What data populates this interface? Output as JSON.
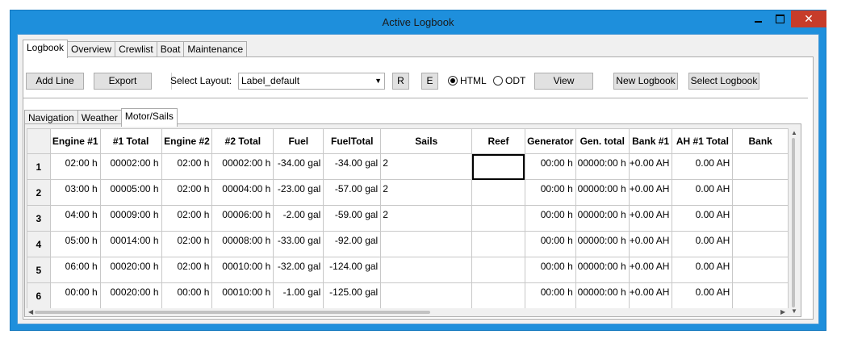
{
  "window": {
    "title": "Active Logbook",
    "close_glyph": "✕"
  },
  "outer_tabs": [
    {
      "label": "Logbook",
      "active": true
    },
    {
      "label": "Overview"
    },
    {
      "label": "Crewlist"
    },
    {
      "label": "Boat"
    },
    {
      "label": "Maintenance"
    }
  ],
  "toolbar": {
    "add_line": "Add Line",
    "export": "Export",
    "select_layout_label": "Select Layout:",
    "layout_value": "Label_default",
    "r_button": "R",
    "e_button": "E",
    "html_radio": "HTML",
    "odt_radio": "ODT",
    "view": "View",
    "new_logbook": "New Logbook",
    "select_logbook": "Select Logbook"
  },
  "inner_tabs": [
    {
      "label": "Navigation"
    },
    {
      "label": "Weather"
    },
    {
      "label": "Motor/Sails",
      "active": true
    }
  ],
  "grid": {
    "columns": [
      "Engine #1",
      "#1 Total",
      "Engine #2",
      "#2 Total",
      "Fuel",
      "FuelTotal",
      "Sails",
      "Reef",
      "Generator",
      "Gen. total",
      "Bank #1",
      "AH #1 Total",
      "Bank"
    ],
    "rows": [
      {
        "n": "1",
        "cells": [
          "02:00 h",
          "00002:00 h",
          "02:00 h",
          "00002:00 h",
          "-34.00 gal",
          "-34.00 gal",
          "2",
          "",
          "00:00 h",
          "00000:00 h",
          "+0.00 AH",
          "0.00 AH",
          ""
        ]
      },
      {
        "n": "2",
        "cells": [
          "03:00 h",
          "00005:00 h",
          "02:00 h",
          "00004:00 h",
          "-23.00 gal",
          "-57.00 gal",
          "2",
          "",
          "00:00 h",
          "00000:00 h",
          "+0.00 AH",
          "0.00 AH",
          ""
        ]
      },
      {
        "n": "3",
        "cells": [
          "04:00 h",
          "00009:00 h",
          "02:00 h",
          "00006:00 h",
          "-2.00 gal",
          "-59.00 gal",
          "2",
          "",
          "00:00 h",
          "00000:00 h",
          "+0.00 AH",
          "0.00 AH",
          ""
        ]
      },
      {
        "n": "4",
        "cells": [
          "05:00 h",
          "00014:00 h",
          "02:00 h",
          "00008:00 h",
          "-33.00 gal",
          "-92.00 gal",
          "",
          "",
          "00:00 h",
          "00000:00 h",
          "+0.00 AH",
          "0.00 AH",
          ""
        ]
      },
      {
        "n": "5",
        "cells": [
          "06:00 h",
          "00020:00 h",
          "02:00 h",
          "00010:00 h",
          "-32.00 gal",
          "-124.00 gal",
          "",
          "",
          "00:00 h",
          "00000:00 h",
          "+0.00 AH",
          "0.00 AH",
          ""
        ]
      },
      {
        "n": "6",
        "cells": [
          "00:00 h",
          "00020:00 h",
          "00:00 h",
          "00010:00 h",
          "-1.00 gal",
          "-125.00 gal",
          "",
          "",
          "00:00 h",
          "00000:00 h",
          "+0.00 AH",
          "0.00 AH",
          ""
        ]
      }
    ]
  }
}
